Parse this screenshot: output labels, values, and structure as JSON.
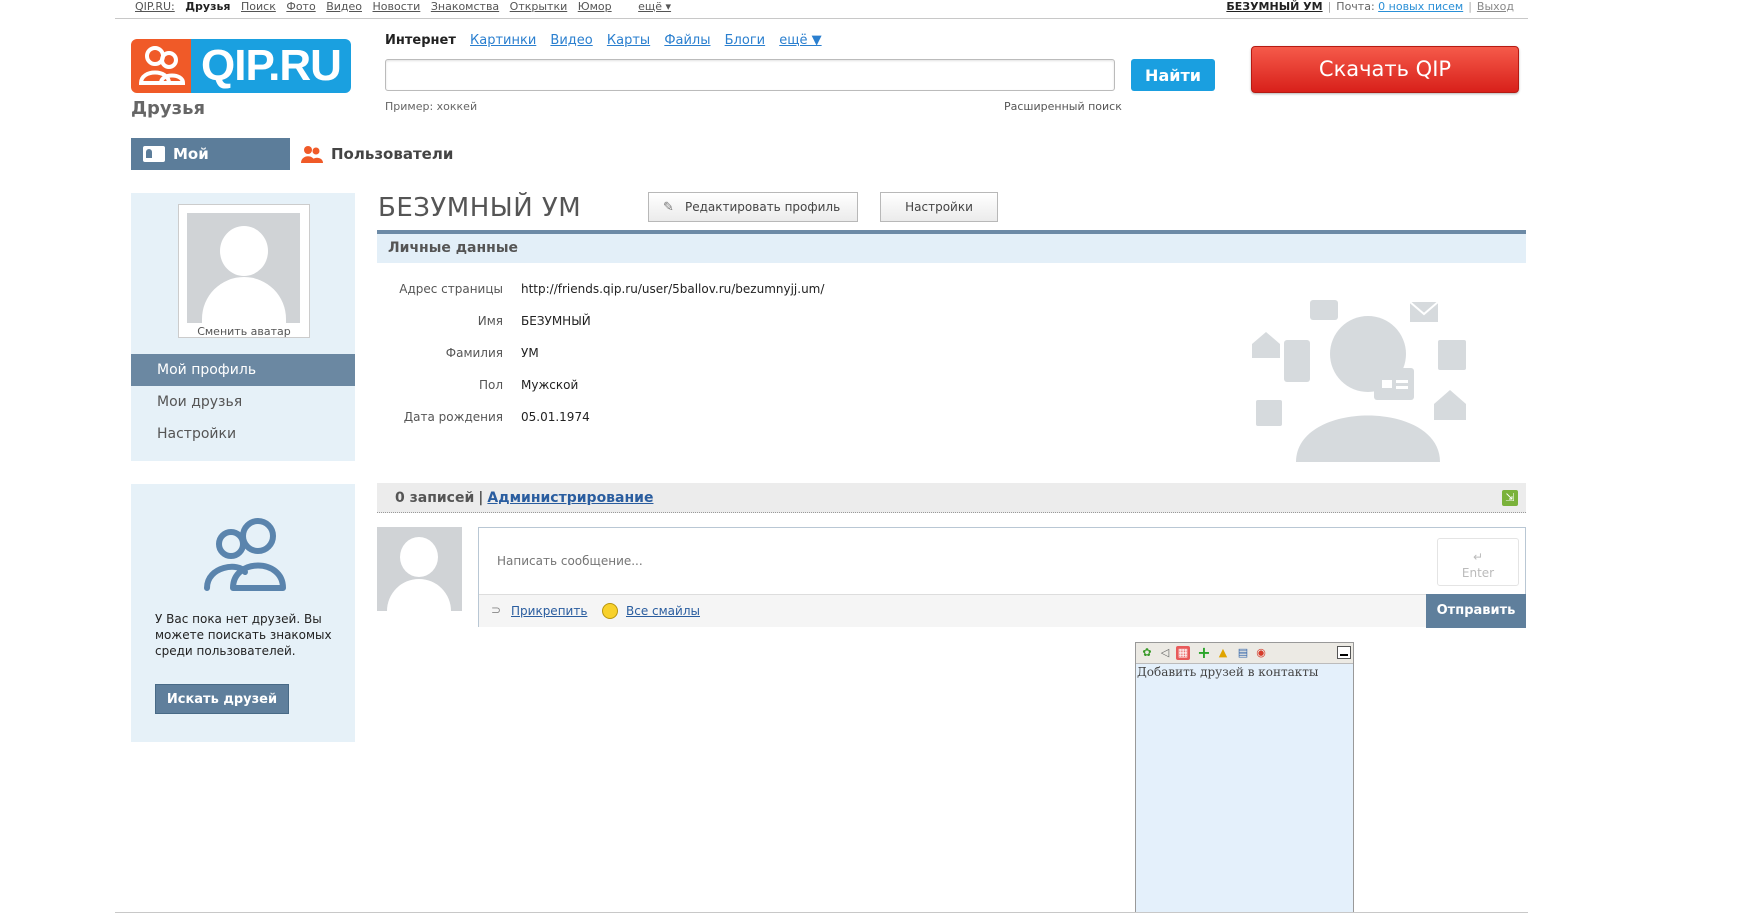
{
  "topbar": {
    "nav": [
      "QIP.RU:",
      "Друзья",
      "Поиск",
      "Фото",
      "Видео",
      "Новости",
      "Знакомства",
      "Открытки",
      "Юмор",
      "ещё ▾"
    ],
    "user_name": "БЕЗУМНЫЙ УМ",
    "mail_label": "Почта:",
    "mail_count": "0 новых писем",
    "logout": "Выход"
  },
  "logo": {
    "text": "QIP.RU",
    "subtitle": "Друзья"
  },
  "search": {
    "tabs": [
      "Интернет",
      "Картинки",
      "Видео",
      "Карты",
      "Файлы",
      "Блоги",
      "ещё ▼"
    ],
    "value": "",
    "button": "Найти",
    "example": "Пример: хоккей",
    "advanced": "Расширенный поиск"
  },
  "download_button": "Скачать QIP",
  "nav_tabs": {
    "profile": "Мой профиль",
    "users": "Пользователи"
  },
  "sidebar": {
    "change_avatar": "Сменить аватар",
    "items": [
      "Мой профиль",
      "Мои друзья",
      "Настройки"
    ],
    "no_friends_text": "У Вас пока нет друзей. Вы можете поискать знакомых среди пользователей.",
    "find_friends_button": "Искать друзей"
  },
  "profile": {
    "name": "БЕЗУМНЫЙ УМ",
    "edit_button": "Редактировать профиль",
    "settings_button": "Настройки",
    "section_title": "Личные данные",
    "fields": [
      {
        "label": "Адрес страницы",
        "value": "http://friends.qip.ru/user/5ballov.ru/bezumnyjj.um/"
      },
      {
        "label": "Имя",
        "value": "БЕЗУМНЫЙ"
      },
      {
        "label": "Фамилия",
        "value": "УМ"
      },
      {
        "label": "Пол",
        "value": "Мужской"
      },
      {
        "label": "Дата рождения",
        "value": "05.01.1974"
      }
    ]
  },
  "wall": {
    "count": "0 записей",
    "separator": "|",
    "admin_link": "Администрирование",
    "placeholder": "Написать сообщение...",
    "enter_hint": "Enter",
    "attach": "Прикрепить",
    "smiles": "Все смайлы",
    "send": "Отправить"
  },
  "widget": {
    "text": "Добавить друзей в контакты"
  },
  "colors": {
    "accent_blue": "#1aa0e0",
    "logo_orange": "#f05a28",
    "nav_steel": "#5c7d9a",
    "download_red": "#d8201a"
  }
}
